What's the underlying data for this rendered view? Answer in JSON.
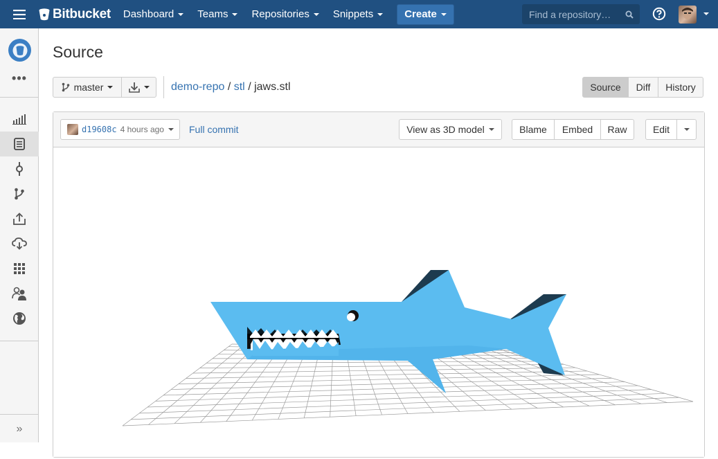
{
  "topbar": {
    "brand": "Bitbucket",
    "nav": [
      "Dashboard",
      "Teams",
      "Repositories",
      "Snippets"
    ],
    "create_label": "Create",
    "search_placeholder": "Find a repository…"
  },
  "sidebar": {
    "more": "•••",
    "items": [
      "overview-icon",
      "source-icon",
      "commits-icon",
      "branches-icon",
      "pull-requests-icon",
      "downloads-icon",
      "boards-icon",
      "team-icon",
      "web-icon"
    ],
    "expand": "»"
  },
  "page": {
    "title": "Source",
    "branch": "master",
    "breadcrumb": {
      "repo": "demo-repo",
      "dir": "stl",
      "file": "jaws.stl",
      "sep": "/"
    },
    "view_tabs": [
      "Source",
      "Diff",
      "History"
    ],
    "active_tab": "Source"
  },
  "file_header": {
    "commit_hash": "d19608c",
    "commit_time": "4 hours ago",
    "full_commit": "Full commit",
    "view_as": "View as 3D model",
    "actions": [
      "Blame",
      "Embed",
      "Raw"
    ],
    "edit": "Edit"
  },
  "colors": {
    "topbar": "#205081",
    "create": "#3572b0",
    "link": "#3572b0",
    "shark": "#5bbcf0",
    "shark_dark": "#1d3b4f"
  }
}
